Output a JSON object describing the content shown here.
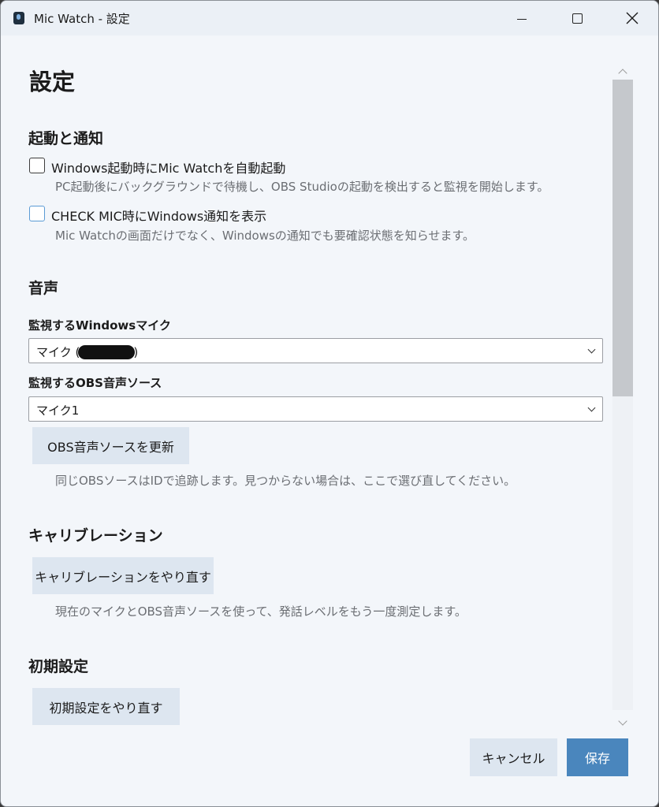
{
  "window": {
    "title": "Mic Watch - 設定"
  },
  "page": {
    "title": "設定"
  },
  "startup": {
    "section_title": "起動と通知",
    "autostart_label": "Windows起動時にMic Watchを自動起動",
    "autostart_desc": "PC起動後にバックグラウンドで待機し、OBS Studioの起動を検出すると監視を開始します。",
    "autostart_checked": false,
    "notify_label": "CHECK MIC時にWindows通知を表示",
    "notify_desc": "Mic Watchの画面だけでなく、Windowsの通知でも要確認状態を知らせます。",
    "notify_checked": false
  },
  "audio": {
    "section_title": "音声",
    "mic_label": "監視するWindowsマイク",
    "mic_value_prefix": "マイク (",
    "mic_value_suffix": ")",
    "obs_label": "監視するOBS音声ソース",
    "obs_value": "マイク1",
    "refresh_button": "OBS音声ソースを更新",
    "refresh_desc": "同じOBSソースはIDで追跡します。見つからない場合は、ここで選び直してください。"
  },
  "calibration": {
    "section_title": "キャリブレーション",
    "redo_button": "キャリブレーションをやり直す",
    "redo_desc": "現在のマイクとOBS音声ソースを使って、発話レベルをもう一度測定します。"
  },
  "reset": {
    "section_title": "初期設定",
    "redo_button": "初期設定をやり直す"
  },
  "footer": {
    "cancel_label": "キャンセル",
    "save_label": "保存"
  },
  "colors": {
    "accent": "#4a86bd",
    "window_bg": "#f3f6fa",
    "button_bg": "#dde6f0"
  }
}
